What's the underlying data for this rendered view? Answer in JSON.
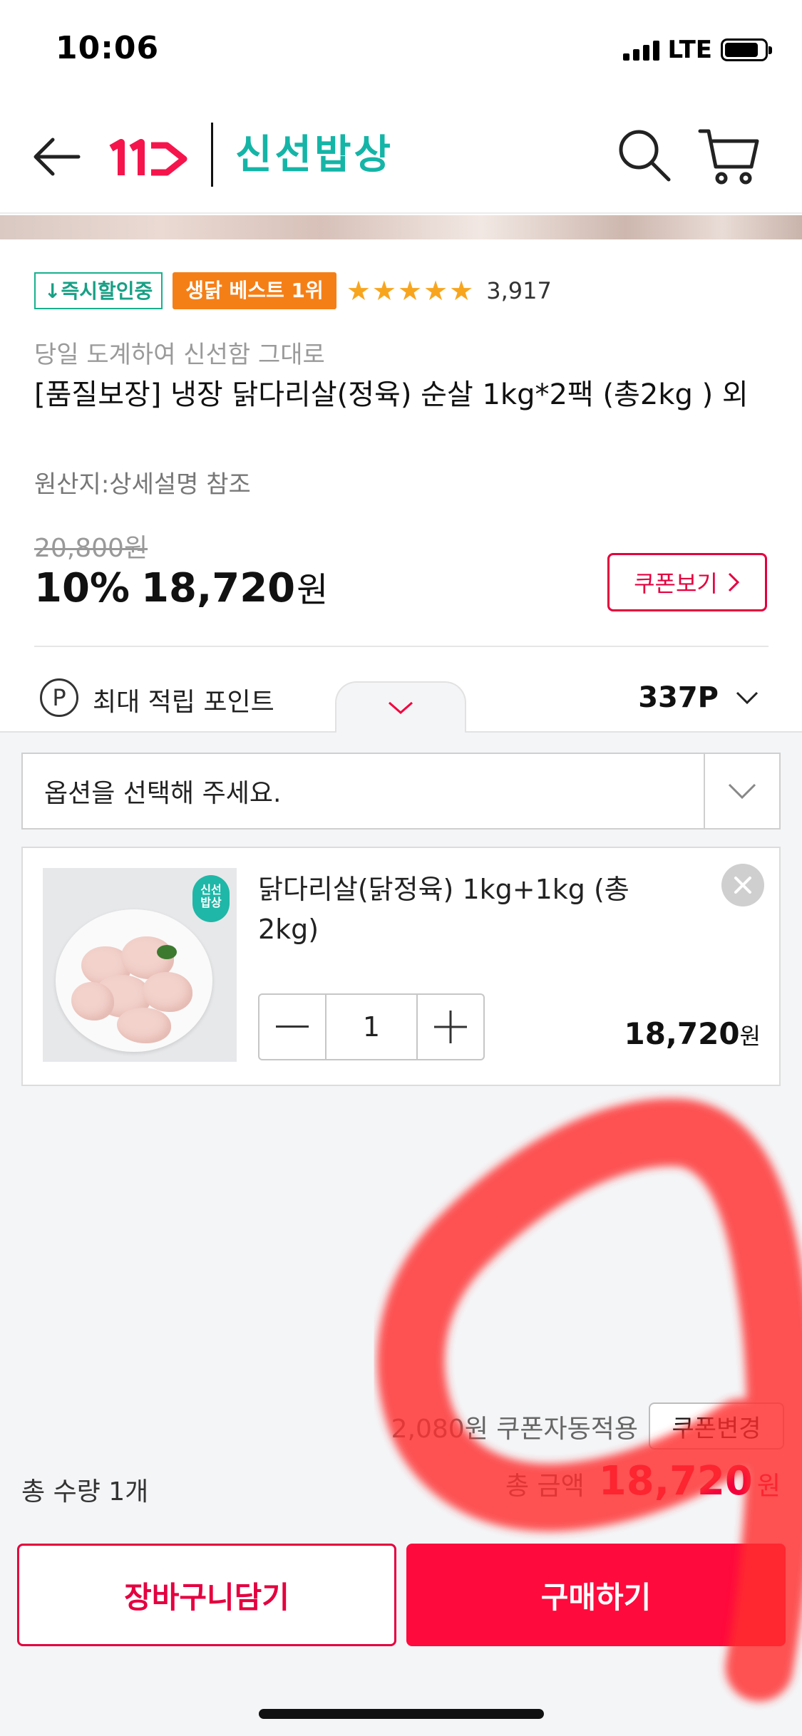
{
  "status_bar": {
    "time": "10:06",
    "network": "LTE",
    "battery_level": 0.85
  },
  "header": {
    "logo_text": "11",
    "brand_name": "신선밥상",
    "icons": [
      "back-arrow-icon",
      "search-icon",
      "cart-icon"
    ]
  },
  "product": {
    "badge_instant": "↓즉시할인중",
    "badge_best": "생닭 베스트 1위",
    "rating": 5,
    "review_count": "3,917",
    "subtitle": "당일 도계하여 신선함 그대로",
    "title": "[품질보장] 냉장 닭다리살(정육) 순살 1kg*2팩 (총2kg ) 외",
    "origin": "원산지:상세설명 참조",
    "original_price": "20,800원",
    "discount": "10%",
    "sale_price": "18,720",
    "sale_currency": "원",
    "coupon_view_label": "쿠폰보기"
  },
  "points": {
    "icon_letter": "P",
    "label": "최대 적립 포인트",
    "value": "337P"
  },
  "option_panel": {
    "select_placeholder": "옵션을 선택해 주세요.",
    "selected_option": {
      "thumb_badge": "신선\n밥상",
      "name": "닭다리살(닭정육) 1kg+1kg (총2kg)",
      "quantity": "1",
      "price": "18,720",
      "currency": "원"
    },
    "coupon_info": "2,080원 쿠폰자동적용",
    "coupon_change_label": "쿠폰변경",
    "total_qty": "총 수량 1개",
    "total_label": "총 금액",
    "total_amount": "18,720",
    "total_currency": "원"
  },
  "actions": {
    "cart_label": "장바구니담기",
    "buy_label": "구매하기"
  },
  "colors": {
    "brand_red": "#e4003f",
    "brand_teal": "#14b5a7",
    "buy_button": "#ff0a3d",
    "badge_best": "#f57f17",
    "star": "#f8a51e",
    "scribble": "#ff2d2d"
  }
}
